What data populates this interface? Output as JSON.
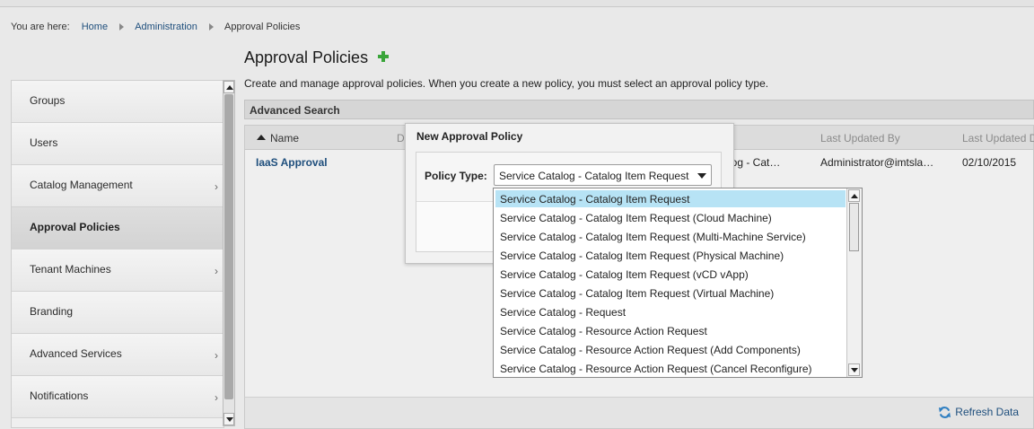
{
  "breadcrumb": {
    "prefix": "You are here:",
    "items": [
      "Home",
      "Administration",
      "Approval Policies"
    ]
  },
  "sidebar": {
    "items": [
      {
        "label": "Groups"
      },
      {
        "label": "Users"
      },
      {
        "label": "Catalog Management",
        "chevron": "›"
      },
      {
        "label": "Approval Policies"
      },
      {
        "label": "Tenant Machines",
        "chevron": "›"
      },
      {
        "label": "Branding"
      },
      {
        "label": "Advanced Services",
        "chevron": "›"
      },
      {
        "label": "Notifications",
        "chevron": "›"
      }
    ]
  },
  "page": {
    "title": "Approval Policies",
    "description": "Create and manage approval policies. When you create a new policy, you must select an approval policy type.",
    "advanced_search": "Advanced Search"
  },
  "grid": {
    "columns": [
      "Name",
      "D",
      "Last Updated By",
      "Last Updated D"
    ],
    "row": {
      "name": "IaaS Approval",
      "type_fragment": "talog - Cat…",
      "updated_by": "Administrator@imtsla…",
      "updated_date": "02/10/2015"
    },
    "refresh_label": "Refresh Data"
  },
  "modal": {
    "title": "New Approval Policy",
    "policy_type_label": "Policy Type:",
    "selected_value": "Service Catalog - Catalog Item Request"
  },
  "dropdown": {
    "options": [
      "Service Catalog - Catalog Item Request",
      "Service Catalog - Catalog Item Request (Cloud Machine)",
      "Service Catalog - Catalog Item Request (Multi-Machine Service)",
      "Service Catalog - Catalog Item Request (Physical Machine)",
      "Service Catalog - Catalog Item Request (vCD vApp)",
      "Service Catalog - Catalog Item Request (Virtual Machine)",
      "Service Catalog - Request",
      "Service Catalog - Resource Action Request",
      "Service Catalog - Resource Action Request (Add Components)",
      "Service Catalog - Resource Action Request (Cancel Reconfigure)"
    ]
  },
  "colors": {
    "link": "#1f4f7d",
    "add_icon": "#3aa53a",
    "selected_option": "#b7e3f5",
    "refresh_icon": "#2f7fc1"
  }
}
